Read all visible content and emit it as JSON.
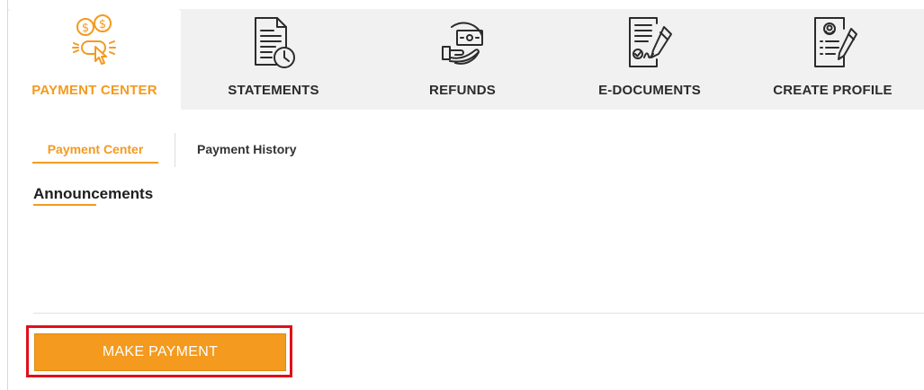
{
  "tabs": [
    {
      "label": "PAYMENT CENTER",
      "icon": "payment-click-icon"
    },
    {
      "label": "STATEMENTS",
      "icon": "statement-clock-icon"
    },
    {
      "label": "REFUNDS",
      "icon": "refund-hand-cash-icon"
    },
    {
      "label": "E-DOCUMENTS",
      "icon": "document-signature-icon"
    },
    {
      "label": "CREATE PROFILE",
      "icon": "profile-edit-icon"
    }
  ],
  "subtabs": {
    "active": "Payment Center",
    "other": "Payment History"
  },
  "section": {
    "title": "Announcements"
  },
  "actions": {
    "make_payment": "MAKE PAYMENT"
  },
  "colors": {
    "accent": "#f39a1f",
    "highlight": "#e0101a"
  }
}
